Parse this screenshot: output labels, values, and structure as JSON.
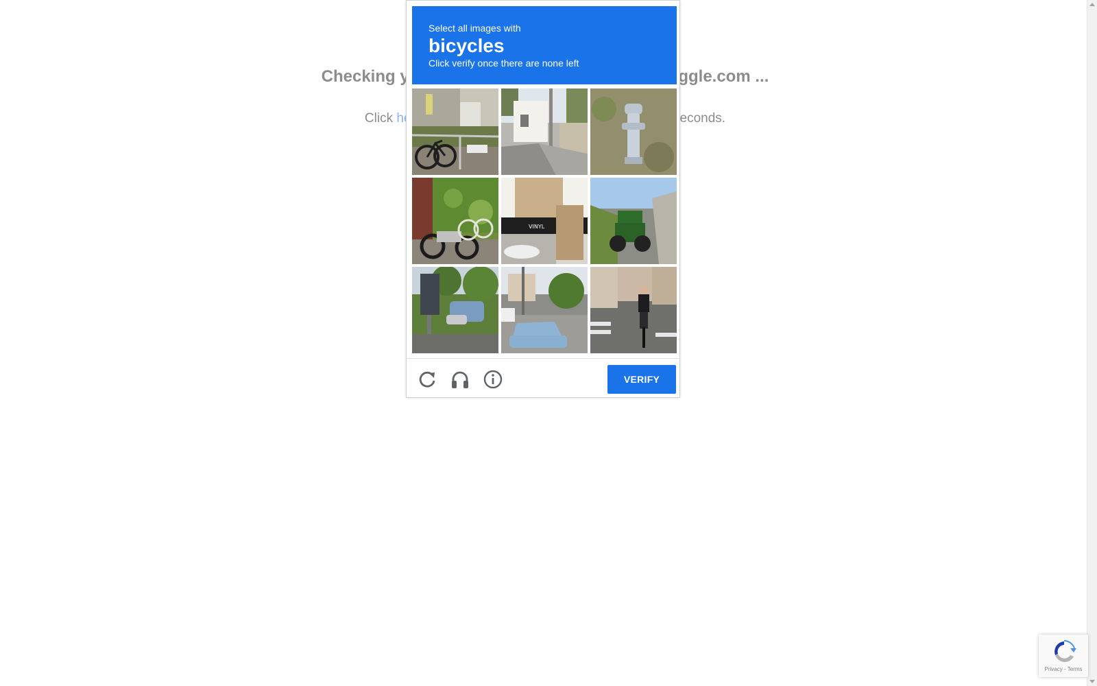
{
  "background": {
    "heading_left": "Checking you",
    "heading_right": "aggle.com ...",
    "text_left": "Click ",
    "link_text": "he",
    "text_right": "econds."
  },
  "captcha": {
    "instruction": "Select all images with",
    "target": "bicycles",
    "subinstruction": "Click verify once there are none left",
    "tiles": [
      {
        "scene": "bicycle-leaning-on-railing"
      },
      {
        "scene": "street-with-white-house"
      },
      {
        "scene": "fire-hydrant-in-grass"
      },
      {
        "scene": "motorcycle-and-bicycle-by-ivy"
      },
      {
        "scene": "storefront-with-vinyl-sign"
      },
      {
        "scene": "green-tractor-on-road"
      },
      {
        "scene": "bus-and-sign-by-trees"
      },
      {
        "scene": "blue-car-parked-on-street"
      },
      {
        "scene": "person-riding-bicycle"
      }
    ],
    "reload_icon": "reload-icon",
    "audio_icon": "headphones-icon",
    "info_icon": "info-icon",
    "verify_label": "VERIFY",
    "accent_color": "#1a73e8"
  },
  "badge": {
    "text": "Privacy - Terms"
  }
}
